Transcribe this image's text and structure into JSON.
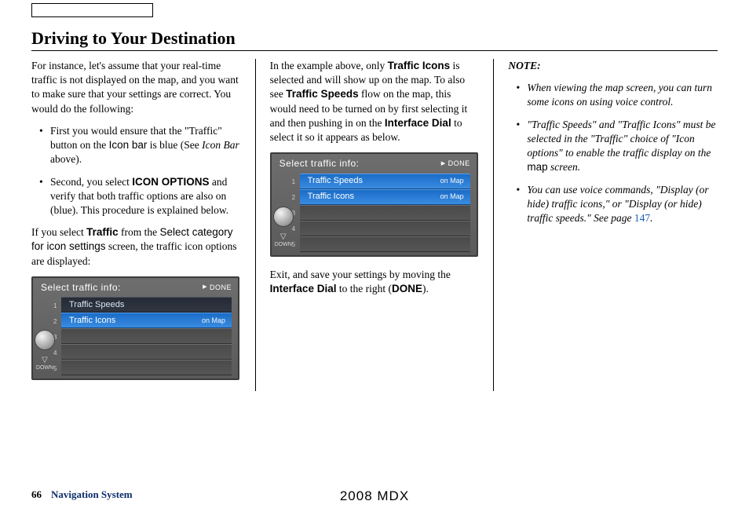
{
  "header": {
    "title": "Driving to Your Destination"
  },
  "col1": {
    "intro": "For instance, let's assume that your real-time traffic is not displayed on the map, and you want to make sure that your settings are correct. You would do the following:",
    "b1a": "First you would ensure that the \"Traffic\" button on the ",
    "b1b": "Icon bar",
    "b1c": " is blue (See ",
    "b1d": "Icon Bar",
    "b1e": " above).",
    "b2a": "Second, you select ",
    "b2b": "ICON OPTIONS",
    "b2c": " and verify that both traffic options are also on (blue). This procedure is explained below.",
    "p2a": "If you select ",
    "p2b": "Traffic",
    "p2c": " from the ",
    "p2d": "Select category for icon settings",
    "p2e": " screen, the traffic icon options are displayed:"
  },
  "ui1": {
    "title": "Select traffic info:",
    "done": "DONE",
    "row1": "Traffic Speeds",
    "row2": "Traffic Icons",
    "row2status": "on Map",
    "down": "DOWN"
  },
  "col2": {
    "p1a": "In the example above, only ",
    "p1b": "Traffic Icons",
    "p1c": " is selected and will show up on the map. To also see ",
    "p1d": "Traffic Speeds",
    "p1e": " flow on the map, this would need to be turned on by first selecting it and then pushing in on the ",
    "p1f": "Interface Dial",
    "p1g": " to select it so it appears as below.",
    "p2a": "Exit, and save your settings by moving the ",
    "p2b": "Interface Dial",
    "p2c": " to the right (",
    "p2d": "DONE",
    "p2e": ")."
  },
  "ui2": {
    "title": "Select traffic info:",
    "done": "DONE",
    "row1": "Traffic Speeds",
    "row1status": "on Map",
    "row2": "Traffic Icons",
    "row2status": "on Map",
    "down": "DOWN"
  },
  "col3": {
    "noteTitle": "NOTE:",
    "n1": "When viewing the map screen, you can turn some icons on using voice control.",
    "n2a": "\"Traffic Speeds\" and \"Traffic Icons\" must be selected in the \"Traffic\" choice of \"Icon options\" to enable the traffic display on the ",
    "n2b": "map",
    "n2c": " screen.",
    "n3a": "You can use voice commands, \"Display (or hide) traffic icons,\" or \"Display (or hide) traffic speeds.\" See page ",
    "n3b": "147",
    "n3c": "."
  },
  "footer": {
    "pageNum": "66",
    "section": "Navigation System",
    "model": "2008 MDX"
  }
}
